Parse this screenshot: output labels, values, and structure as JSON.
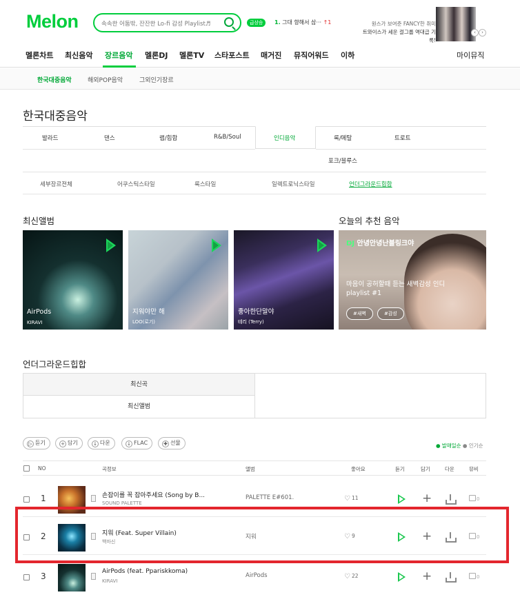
{
  "header": {
    "logo": "Melon",
    "search_placeholder": "속속한 어둠밖, 잔잔한 Lo-fi 감성 Playlist♬",
    "rank_badge": "급상승",
    "rank_number": "1.",
    "rank_text": "그대 향해서 삼···",
    "rank_change": "↑1",
    "promo_line1": "원스가 보여준 FANCY한 취미",
    "promo_line2": "트와이스가 세운 걸그룹 역대급 기록!",
    "prev_icon": "chevron-left-icon",
    "next_icon": "chevron-right-icon"
  },
  "gnb": [
    "멜론차트",
    "최신음악",
    "장르음악",
    "멜론DJ",
    "멜론TV",
    "스타포스트",
    "매거진",
    "뮤직어워드",
    "이하"
  ],
  "gnb_right": "마이뮤직",
  "subnav": [
    "한국대중음악",
    "해외POP음악",
    "그외인기장르"
  ],
  "page_title": "한국대중음악",
  "genres_row1": [
    "발라드",
    "댄스",
    "랩/힙합",
    "R&B/Soul",
    "인디음악",
    "록/메탈",
    "트로트"
  ],
  "genres_row2": [
    "포크/블루스"
  ],
  "subgenres": [
    "세부장르전체",
    "어쿠스틱스타일",
    "록스타일",
    "일렉트로닉스타일",
    "언더그라운드힙합"
  ],
  "new_albums_title": "최신앨범",
  "albums": [
    {
      "title": "AirPods",
      "artist": "KIRAVI"
    },
    {
      "title": "지워야만 해",
      "artist": "LOO(로기)"
    },
    {
      "title": "좋아한단말야",
      "artist": "테리 (Terry)"
    }
  ],
  "recommend": {
    "title": "오늘의 추천 음악",
    "dj_badge": "DJ",
    "dj_name": "안녕안녕난블링크야",
    "description": "마음이 공허할때 듣는 새벽감성 인디 playlist #1",
    "tags": [
      "#새벽",
      "#감성"
    ]
  },
  "underground": {
    "title": "언더그라운드힙합",
    "tab_new_songs": "최신곡",
    "tab_new_albums": "최신앨범"
  },
  "toolbar": {
    "listen": "듣기",
    "add": "담기",
    "download": "다운",
    "flac": "FLAC",
    "gift": "선물",
    "sort_sales": "● 발매일순",
    "sort_popular": "● 인기순"
  },
  "table_head": {
    "no": "NO",
    "song": "곡정보",
    "album": "앨범",
    "like": "좋아요",
    "listen": "듣기",
    "add": "담기",
    "download": "다운",
    "mv": "뮤비"
  },
  "rows": [
    {
      "no": "1",
      "title": "손잡이를 꼭 잡아주세요 (Song by B...",
      "artist": "SOUND PALETTE",
      "album": "PALETTE E#601.",
      "likes": "11",
      "mv": "0"
    },
    {
      "no": "2",
      "title": "지워 (Feat. Super Villain)",
      "artist": "백마신",
      "album": "지워",
      "likes": "9",
      "mv": "0"
    },
    {
      "no": "3",
      "title": "AirPods (feat. Ppariskkoma)",
      "artist": "KIRAVI",
      "album": "AirPods",
      "likes": "22",
      "mv": "0"
    }
  ]
}
